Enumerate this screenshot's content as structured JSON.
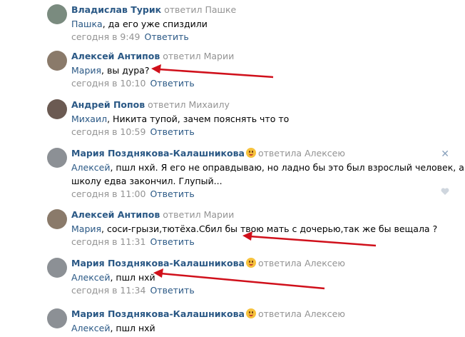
{
  "comments": [
    {
      "author": "Владислав Турик",
      "action": "ответил Пашке",
      "emoji": false,
      "mention": "Пашка",
      "text": ", да его уже спиздили",
      "text2": "",
      "time": "сегодня в 9:49",
      "reply": "Ответить",
      "avatar_color": "#7a8b7f"
    },
    {
      "author": "Алексей Антипов",
      "action": "ответил Марии",
      "emoji": false,
      "mention": "Мария",
      "text": ", вы дура?",
      "text2": "",
      "time": "сегодня в 10:10",
      "reply": "Ответить",
      "avatar_color": "#8a7a6a"
    },
    {
      "author": "Андрей Попов",
      "action": "ответил Михаилу",
      "emoji": false,
      "mention": "Михаил",
      "text": ", Никита тупой, зачем пояснять что то",
      "text2": "",
      "time": "сегодня в 10:59",
      "reply": "Ответить",
      "avatar_color": "#6b5a52"
    },
    {
      "author": "Мария Позднякова-Калашникова",
      "action": "ответила Алексею",
      "emoji": true,
      "mention": "Алексей",
      "text": ", пшл нхй. Я его не оправдываю, но ладно бы это был взрослый человек, а тут",
      "text2": "школу едва закончил. Глупый...",
      "time": "сегодня в 11:00",
      "reply": "Ответить",
      "avatar_color": "#8c9095"
    },
    {
      "author": "Алексей Антипов",
      "action": "ответил Марии",
      "emoji": false,
      "mention": "Мария",
      "text": ", соси-грызи,тютёха.Сбил бы твою мать с дочерью,так же бы вещала ?",
      "text2": "",
      "time": "сегодня в 11:31",
      "reply": "Ответить",
      "avatar_color": "#8a7a6a"
    },
    {
      "author": "Мария Позднякова-Калашникова",
      "action": "ответила Алексею",
      "emoji": true,
      "mention": "Алексей",
      "text": ", пшл нхй",
      "text2": "",
      "time": "сегодня в 11:34",
      "reply": "Ответить",
      "avatar_color": "#8c9095"
    },
    {
      "author": "Мария Позднякова-Калашникова",
      "action": "ответила Алексею",
      "emoji": true,
      "mention": "Алексей",
      "text": ", пшл нхй",
      "text2": "",
      "time": "",
      "reply": "",
      "avatar_color": "#8c9095"
    }
  ],
  "colors": {
    "link": "#2a5885",
    "muted": "#939393",
    "arrow": "#d0101b"
  },
  "icons": {
    "close": "close-icon",
    "like": "heart-icon",
    "emoji": "emoji-icon"
  }
}
